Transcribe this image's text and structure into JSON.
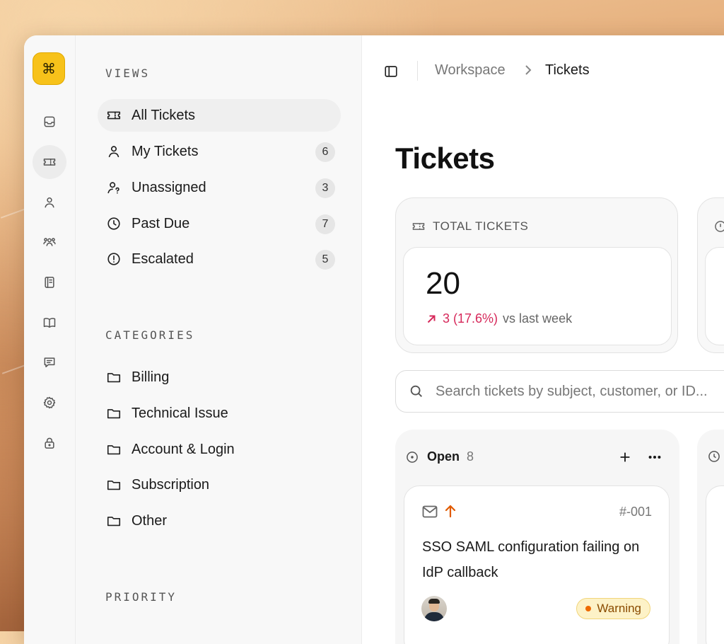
{
  "colors": {
    "brand": "#f7c21a",
    "delta_up": "#d6285a",
    "priority_high": "#e05a00",
    "warning_bg": "#fdf2c7",
    "warning_text": "#8a4b00"
  },
  "rail": {
    "logo_glyph": "⌘",
    "icons": [
      "inbox-icon",
      "ticket-icon",
      "user-icon",
      "users-icon",
      "notebook-icon",
      "book-icon",
      "chat-icon",
      "settings-icon",
      "lock-icon"
    ],
    "active": "ticket-icon"
  },
  "sidebar": {
    "views_label": "VIEWS",
    "views": [
      {
        "label": "All Tickets",
        "icon": "ticket-icon",
        "count": null,
        "active": true
      },
      {
        "label": "My Tickets",
        "icon": "user-icon",
        "count": "6"
      },
      {
        "label": "Unassigned",
        "icon": "user-question-icon",
        "count": "3"
      },
      {
        "label": "Past Due",
        "icon": "clock-icon",
        "count": "7"
      },
      {
        "label": "Escalated",
        "icon": "alert-circle-icon",
        "count": "5"
      }
    ],
    "categories_label": "CATEGORIES",
    "categories": [
      {
        "label": "Billing",
        "icon": "folder-icon"
      },
      {
        "label": "Technical Issue",
        "icon": "folder-icon"
      },
      {
        "label": "Account & Login",
        "icon": "folder-icon"
      },
      {
        "label": "Subscription",
        "icon": "folder-icon"
      },
      {
        "label": "Other",
        "icon": "folder-icon"
      }
    ],
    "priority_label": "PRIORITY"
  },
  "header": {
    "breadcrumb": [
      "Workspace",
      "Tickets"
    ]
  },
  "main": {
    "title": "Tickets",
    "stats": [
      {
        "label": "TOTAL TICKETS",
        "icon": "ticket-icon",
        "value": "20",
        "delta": "3 (17.6%)",
        "delta_suffix": "vs last week"
      }
    ],
    "search": {
      "placeholder": "Search tickets by subject, customer, or ID..."
    },
    "columns": [
      {
        "name": "Open",
        "count": "8",
        "icon": "circle-dot-icon",
        "tickets": [
          {
            "id": "#-001",
            "channel": "mail-icon",
            "priority": "arrow-up-icon",
            "subject": "SSO SAML configuration failing on IdP callback",
            "status": "Warning"
          }
        ]
      }
    ]
  }
}
